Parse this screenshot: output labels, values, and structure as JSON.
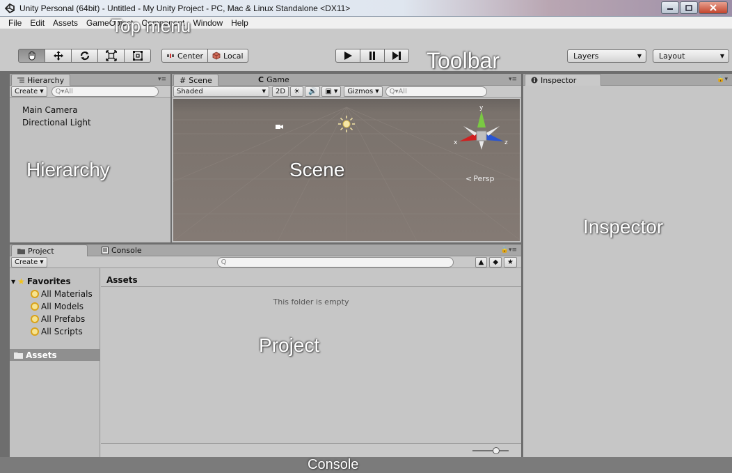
{
  "window": {
    "title": "Unity Personal (64bit) - Untitled - My Unity Project - PC, Mac & Linux Standalone <DX11>"
  },
  "menu": {
    "items": [
      "File",
      "Edit",
      "Assets",
      "GameObject",
      "Component",
      "Window",
      "Help"
    ]
  },
  "toolbar": {
    "pivot_label": "Center",
    "space_label": "Local",
    "layers_label": "Layers",
    "layout_label": "Layout"
  },
  "hierarchy": {
    "tab": "Hierarchy",
    "create_label": "Create",
    "search_placeholder": "Q▾All",
    "items": [
      "Main Camera",
      "Directional Light"
    ]
  },
  "scene": {
    "tab_scene": "Scene",
    "tab_game": "Game",
    "shading": "Shaded",
    "mode_2d": "2D",
    "gizmos": "Gizmos",
    "search_placeholder": "Q▾All",
    "axis_x": "x",
    "axis_y": "y",
    "axis_z": "z",
    "persp": "Persp"
  },
  "inspector": {
    "tab": "Inspector"
  },
  "project": {
    "tab_project": "Project",
    "tab_console": "Console",
    "create_label": "Create",
    "search_placeholder": "Q",
    "favorites_label": "Favorites",
    "favorites": [
      "All Materials",
      "All Models",
      "All Prefabs",
      "All Scripts"
    ],
    "assets_tree_label": "Assets",
    "assets_header": "Assets",
    "empty_message": "This folder is empty"
  },
  "overlays": {
    "top_menu": "Top menu",
    "toolbar": "Toolbar",
    "hierarchy": "Hierarchy",
    "scene": "Scene",
    "inspector": "Inspector",
    "project": "Project",
    "console": "Console"
  },
  "colors": {
    "panel_bg": "#c2c2c2",
    "scene_bg": "#7a726c",
    "toolbar_bg": "#c9c9c9",
    "selected_item": "#8f8f8f"
  }
}
